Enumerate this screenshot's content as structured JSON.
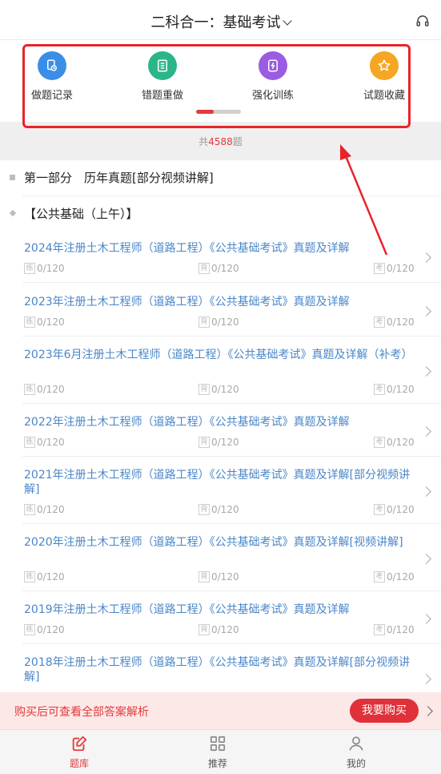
{
  "header": {
    "title": "二科合一：基础考试",
    "headset_icon": "headset-icon"
  },
  "quick_actions": [
    {
      "label": "做题记录",
      "icon": "record-icon",
      "color": "#3b8ee8"
    },
    {
      "label": "错题重做",
      "icon": "notebook-icon",
      "color": "#2bb58a"
    },
    {
      "label": "强化训练",
      "icon": "lightning-icon",
      "color": "#9a5ce0"
    },
    {
      "label": "试题收藏",
      "icon": "star-icon",
      "color": "#f5a623"
    }
  ],
  "pager": {
    "active_fraction": 0.4
  },
  "count": {
    "prefix": "共",
    "number": "4588",
    "suffix": "题"
  },
  "section1": {
    "label": "第一部分　历年真题[部分视频讲解]"
  },
  "section2": {
    "label": "【公共基础（上午）】"
  },
  "stat_tags": {
    "practice": "练",
    "memorize": "背",
    "exam": "考"
  },
  "rows": [
    {
      "title": "2024年注册土木工程师（道路工程）《公共基础考试》真题及详解",
      "practice": "0/120",
      "memorize": "0/120",
      "exam": "0/120"
    },
    {
      "title": "2023年注册土木工程师（道路工程）《公共基础考试》真题及详解",
      "practice": "0/120",
      "memorize": "0/120",
      "exam": "0/120"
    },
    {
      "title": "2023年6月注册土木工程师（道路工程）《公共基础考试》真题及详解（补考）",
      "practice": "0/120",
      "memorize": "0/120",
      "exam": "0/120"
    },
    {
      "title": "2022年注册土木工程师（道路工程）《公共基础考试》真题及详解",
      "practice": "0/120",
      "memorize": "0/120",
      "exam": "0/120"
    },
    {
      "title": "2021年注册土木工程师（道路工程）《公共基础考试》真题及详解[部分视频讲解]",
      "practice": "0/120",
      "memorize": "0/120",
      "exam": "0/120"
    },
    {
      "title": "2020年注册土木工程师（道路工程）《公共基础考试》真题及详解[视频讲解]",
      "practice": "0/120",
      "memorize": "0/120",
      "exam": "0/120"
    },
    {
      "title": "2019年注册土木工程师（道路工程）《公共基础考试》真题及详解",
      "practice": "0/120",
      "memorize": "0/120",
      "exam": "0/120"
    },
    {
      "title": "2018年注册土木工程师（道路工程）《公共基础考试》真题及详解[部分视频讲解]",
      "practice": "",
      "memorize": "",
      "exam": ""
    }
  ],
  "buy": {
    "text": "购买后可查看全部答案解析",
    "button": "我要购买"
  },
  "tabs": [
    {
      "label": "题库",
      "icon": "edit-icon",
      "active": true
    },
    {
      "label": "推荐",
      "icon": "grid-icon",
      "active": false
    },
    {
      "label": "我的",
      "icon": "user-icon",
      "active": false
    }
  ],
  "colors": {
    "accent": "#e33b3b",
    "link": "#4a86c8",
    "annotation": "#e8242a"
  }
}
